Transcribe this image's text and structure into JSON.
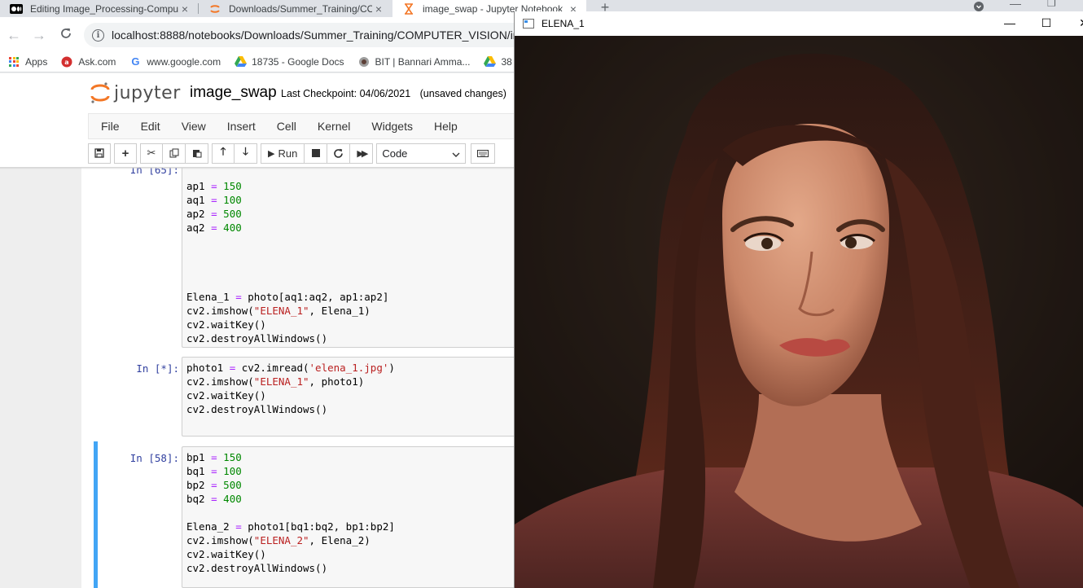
{
  "browser": {
    "tabs": [
      {
        "label": "Editing Image_Processing-Compu",
        "close": "×"
      },
      {
        "label": "Downloads/Summer_Training/CO",
        "close": "×"
      },
      {
        "label": "image_swap - Jupyter Notebook",
        "close": "×"
      }
    ],
    "new_tab": "+",
    "address": "localhost:8888/notebooks/Downloads/Summer_Training/COMPUTER_VISION/im",
    "bookmarks": [
      "Apps",
      "Ask.com",
      "www.google.com",
      "18735 - Google Docs",
      "BIT | Bannari Amma...",
      "38"
    ]
  },
  "jupyter": {
    "logo_text": "jupyter",
    "notebook_title": "image_swap",
    "checkpoint": "Last Checkpoint: 04/06/2021",
    "unsaved": "(unsaved changes)",
    "menu": [
      "File",
      "Edit",
      "View",
      "Insert",
      "Cell",
      "Kernel",
      "Widgets",
      "Help"
    ],
    "toolbar": {
      "run_label": "Run",
      "cell_type": "Code"
    }
  },
  "cells": [
    {
      "prompt": "In [65]:",
      "lines": [
        "ap1 = 150",
        "aq1 = 100",
        "ap2 = 500",
        "aq2 = 400",
        "",
        "",
        "",
        "",
        "Elena_1 = photo[aq1:aq2, ap1:ap2]",
        "cv2.imshow(\"ELENA_1\", Elena_1)",
        "cv2.waitKey()",
        "cv2.destroyAllWindows()"
      ]
    },
    {
      "prompt": "In [*]:",
      "lines": [
        "photo1 = cv2.imread('elena_1.jpg')",
        "cv2.imshow(\"ELENA_1\", photo1)",
        "cv2.waitKey()",
        "cv2.destroyAllWindows()"
      ]
    },
    {
      "prompt": "In [58]:",
      "lines": [
        "bp1 = 150",
        "bq1 = 100",
        "bp2 = 500",
        "bq2 = 400",
        "",
        "Elena_2 = photo1[bq1:bq2, bp1:bp2]",
        "cv2.imshow(\"ELENA_2\", Elena_2)",
        "cv2.waitKey()",
        "cv2.destroyAllWindows()"
      ]
    }
  ],
  "cv_window": {
    "title": "ELENA_1",
    "minimize": "—",
    "maximize": "☐",
    "close": "✕"
  },
  "colors": {
    "selected_cell_border": "#42a5f5",
    "prompt_color": "#303f9f",
    "number_color": "#008800",
    "operator_color": "#aa22ff",
    "string_color": "#ba2121"
  }
}
